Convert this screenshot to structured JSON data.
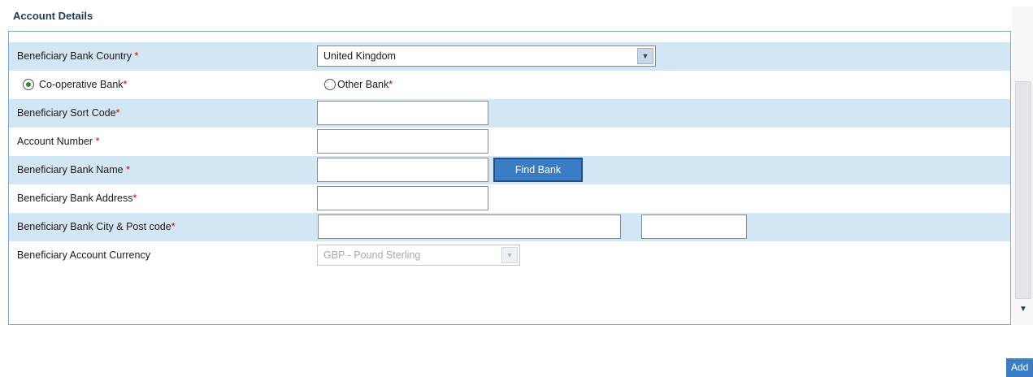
{
  "section": {
    "title": "Account Details"
  },
  "form": {
    "country": {
      "label": "Beneficiary Bank Country",
      "required_mark": "*",
      "value": "United Kingdom"
    },
    "bank_choice": {
      "coop_label": "Co-operative Bank",
      "coop_selected": true,
      "other_label": "Other Bank",
      "other_selected": false,
      "required_mark": "*"
    },
    "sort_code": {
      "label": "Beneficiary Sort Code",
      "required_mark": "*",
      "value": ""
    },
    "account_number": {
      "label": "Account Number",
      "required_mark": "*",
      "value": ""
    },
    "bank_name": {
      "label": "Beneficiary Bank Name",
      "required_mark": "*",
      "value": "",
      "find_button": "Find Bank"
    },
    "bank_address": {
      "label": "Beneficiary Bank Address",
      "required_mark": "*",
      "value": ""
    },
    "city_post": {
      "label": "Beneficiary Bank City & Post code",
      "required_mark": "*",
      "city_value": "",
      "post_value": ""
    },
    "currency": {
      "label": "Beneficiary Account Currency",
      "value": "GBP - Pound Sterling"
    }
  },
  "footer": {
    "add_button": "Add"
  },
  "colors": {
    "row_shade": "#d3e6f4",
    "accent": "#3b7dc4",
    "required": "#cc0000"
  }
}
